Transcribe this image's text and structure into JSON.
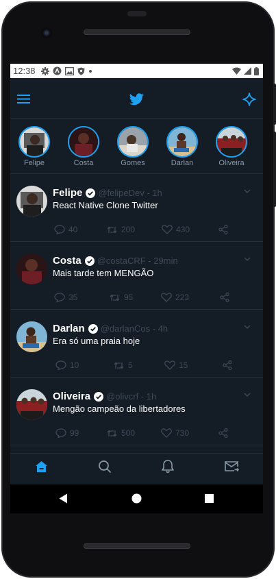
{
  "status_bar": {
    "time": "12:38"
  },
  "header": {
    "menu_icon": "hamburger-menu-icon",
    "logo_icon": "twitter-bird-icon",
    "sparkle_icon": "sparkle-icon"
  },
  "stories": [
    {
      "name": "Felipe"
    },
    {
      "name": "Costa"
    },
    {
      "name": "Gomes"
    },
    {
      "name": "Darlan"
    },
    {
      "name": "Oliveira"
    }
  ],
  "tweets": [
    {
      "name": "Felipe",
      "meta": "@felipeDev - 1h",
      "text": "React Native Clone Twitter",
      "comments": "40",
      "retweets": "200",
      "likes": "430"
    },
    {
      "name": "Costa",
      "meta": "@costaCRF - 29min",
      "text": "Mais tarde tem MENGÃO",
      "comments": "35",
      "retweets": "95",
      "likes": "223"
    },
    {
      "name": "Darlan",
      "meta": "@darlanCos - 4h",
      "text": "Era só uma praia hoje",
      "comments": "10",
      "retweets": "5",
      "likes": "15"
    },
    {
      "name": "Oliveira",
      "meta": "@olivcrf - 1h",
      "text": "Mengão campeão da libertadores",
      "comments": "99",
      "retweets": "500",
      "likes": "730"
    }
  ],
  "tabs": [
    {
      "name": "home-icon",
      "active": true
    },
    {
      "name": "search-icon",
      "active": false
    },
    {
      "name": "bell-icon",
      "active": false
    },
    {
      "name": "mail-icon",
      "active": false
    }
  ],
  "colors": {
    "accent": "#1da1f2",
    "background": "#141d26",
    "muted": "#3e4a57",
    "divider": "#26313d"
  }
}
